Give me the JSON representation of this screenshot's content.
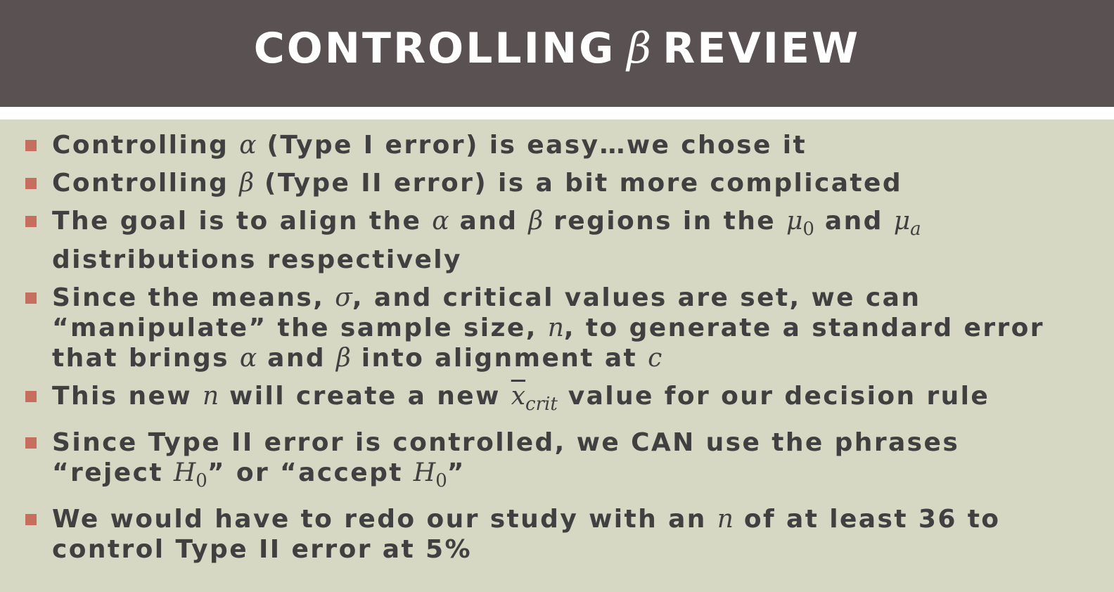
{
  "colors": {
    "title_bar": "#595152",
    "content_bg": "#d6d8c3",
    "bullet_marker": "#c66f5e",
    "text": "#404040"
  },
  "title": {
    "pre": "CONTROLLING",
    "symbol": "β",
    "post": "REVIEW"
  },
  "bullets": [
    {
      "parts": [
        "Controlling ",
        "α",
        " (Type I error) is easy…we chose it"
      ]
    },
    {
      "parts": [
        "Controlling ",
        "β",
        " (Type II error) is a bit more complicated"
      ]
    },
    {
      "parts": [
        "The goal is to align the ",
        "α",
        " and ",
        "β",
        " regions in the ",
        "μ",
        "0",
        " and ",
        "μ",
        "a",
        " distributions respectively"
      ]
    },
    {
      "parts": [
        "Since the means, ",
        "σ",
        ", and critical values are set, we can “manipulate” the sample size, ",
        "n",
        ", to generate a standard error that brings ",
        "α",
        " and ",
        "β",
        " into alignment at ",
        "c"
      ]
    },
    {
      "parts": [
        "This new ",
        "n",
        " will create a new ",
        "x",
        "crit",
        " value for our decision rule"
      ]
    },
    {
      "parts": [
        "Since Type II error is controlled, we CAN use the phrases “reject ",
        "H",
        "0",
        "” or “accept ",
        "H",
        "0",
        "”"
      ]
    },
    {
      "parts": [
        "We would have to redo our study with an ",
        "n",
        " of at least 36 to control Type II error at 5%"
      ]
    }
  ]
}
